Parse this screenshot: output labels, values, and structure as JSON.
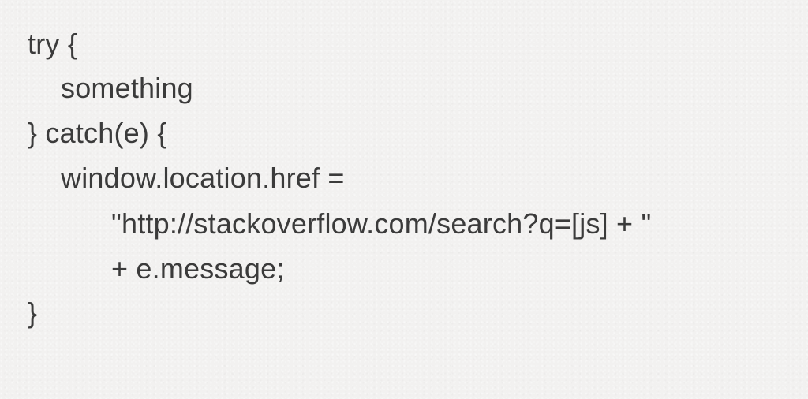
{
  "code_lines": [
    "try {",
    "something",
    "} catch(e) {",
    "window.location.href =",
    "\"http://stackoverflow.com/search?q=[js] + \"",
    "+ e.message;",
    "}"
  ]
}
